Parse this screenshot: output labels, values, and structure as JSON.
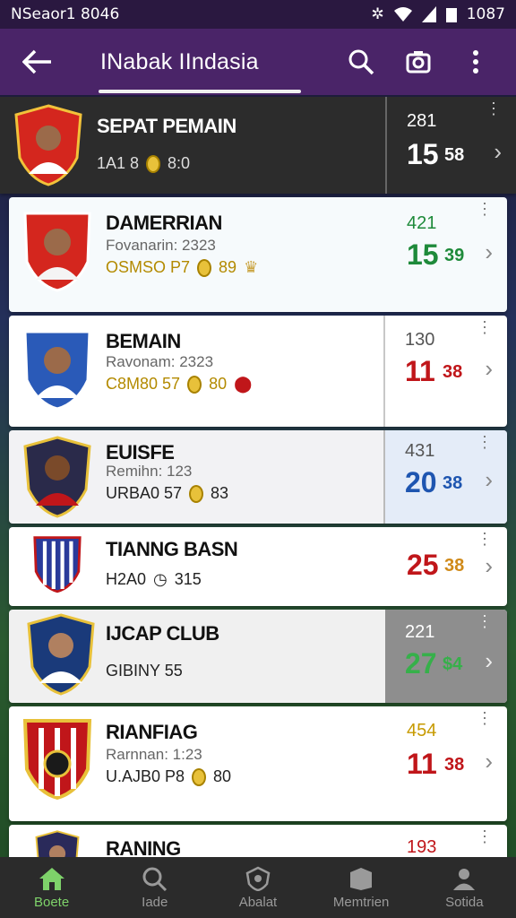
{
  "status": {
    "carrier": "NSeaor1 8046",
    "time": "1087"
  },
  "appbar": {
    "title": "INabak IIndasia"
  },
  "rows": [
    {
      "name": "SEPAT PEMAIN",
      "sub": "",
      "meta": "1A1 8",
      "meta_extra": "8:0",
      "stat_top": "281",
      "stat_big": "15",
      "stat_small": "58",
      "big_color": "#ffffff",
      "small_color": "#ffffff",
      "top_color": "#ffffff"
    },
    {
      "name": "DAMERRIAN",
      "sub": "Fovanarin: 2323",
      "meta": "OSMSO P7",
      "meta_extra": "89",
      "stat_top": "421",
      "stat_big": "15",
      "stat_small": "39",
      "big_color": "#1e8a3a",
      "small_color": "#1e8a3a",
      "top_color": "#1e8a3a"
    },
    {
      "name": "BEMAIN",
      "sub": "Ravonam: 2323",
      "meta": "C8M80 57",
      "meta_extra": "80",
      "stat_top": "130",
      "stat_big": "11",
      "stat_small": "38",
      "big_color": "#c0161a",
      "small_color": "#c0161a",
      "top_color": "#555555"
    },
    {
      "name": "EUISFE",
      "sub": "Remihn: 123",
      "meta": "URBA0 57",
      "meta_extra": "83",
      "stat_top": "431",
      "stat_big": "20",
      "stat_small": "38",
      "big_color": "#1e55b0",
      "small_color": "#1e55b0",
      "top_color": "#555555"
    },
    {
      "name": "TIANNG BASN",
      "sub": "",
      "meta": "H2A0",
      "meta_extra": "315",
      "stat_top": "",
      "stat_big": "25",
      "stat_small": "38",
      "big_color": "#c0161a",
      "small_color": "#d08a1a",
      "top_color": "#555555"
    },
    {
      "name": "IJCAP CLUB",
      "sub": "",
      "meta": "GIBINY 55",
      "meta_extra": "",
      "stat_top": "221",
      "stat_big": "27",
      "stat_small": "$4",
      "big_color": "#36b04a",
      "small_color": "#36b04a",
      "top_color": "#ffffff"
    },
    {
      "name": "RIANFIAG",
      "sub": "Rarnnan: 1:23",
      "meta": "U.AJB0 P8",
      "meta_extra": "80",
      "stat_top": "454",
      "stat_big": "11",
      "stat_small": "38",
      "big_color": "#c0161a",
      "small_color": "#c0161a",
      "top_color": "#c79a00"
    },
    {
      "name": "RANING",
      "sub": "",
      "meta": "",
      "meta_extra": "",
      "stat_top": "193",
      "stat_big": "",
      "stat_small": "",
      "big_color": "#c0161a",
      "small_color": "#c0161a",
      "top_color": "#c0161a"
    }
  ],
  "nav": [
    {
      "label": "Boete"
    },
    {
      "label": "Iade"
    },
    {
      "label": "Abalat"
    },
    {
      "label": "Memtrien"
    },
    {
      "label": "Sotida"
    }
  ]
}
